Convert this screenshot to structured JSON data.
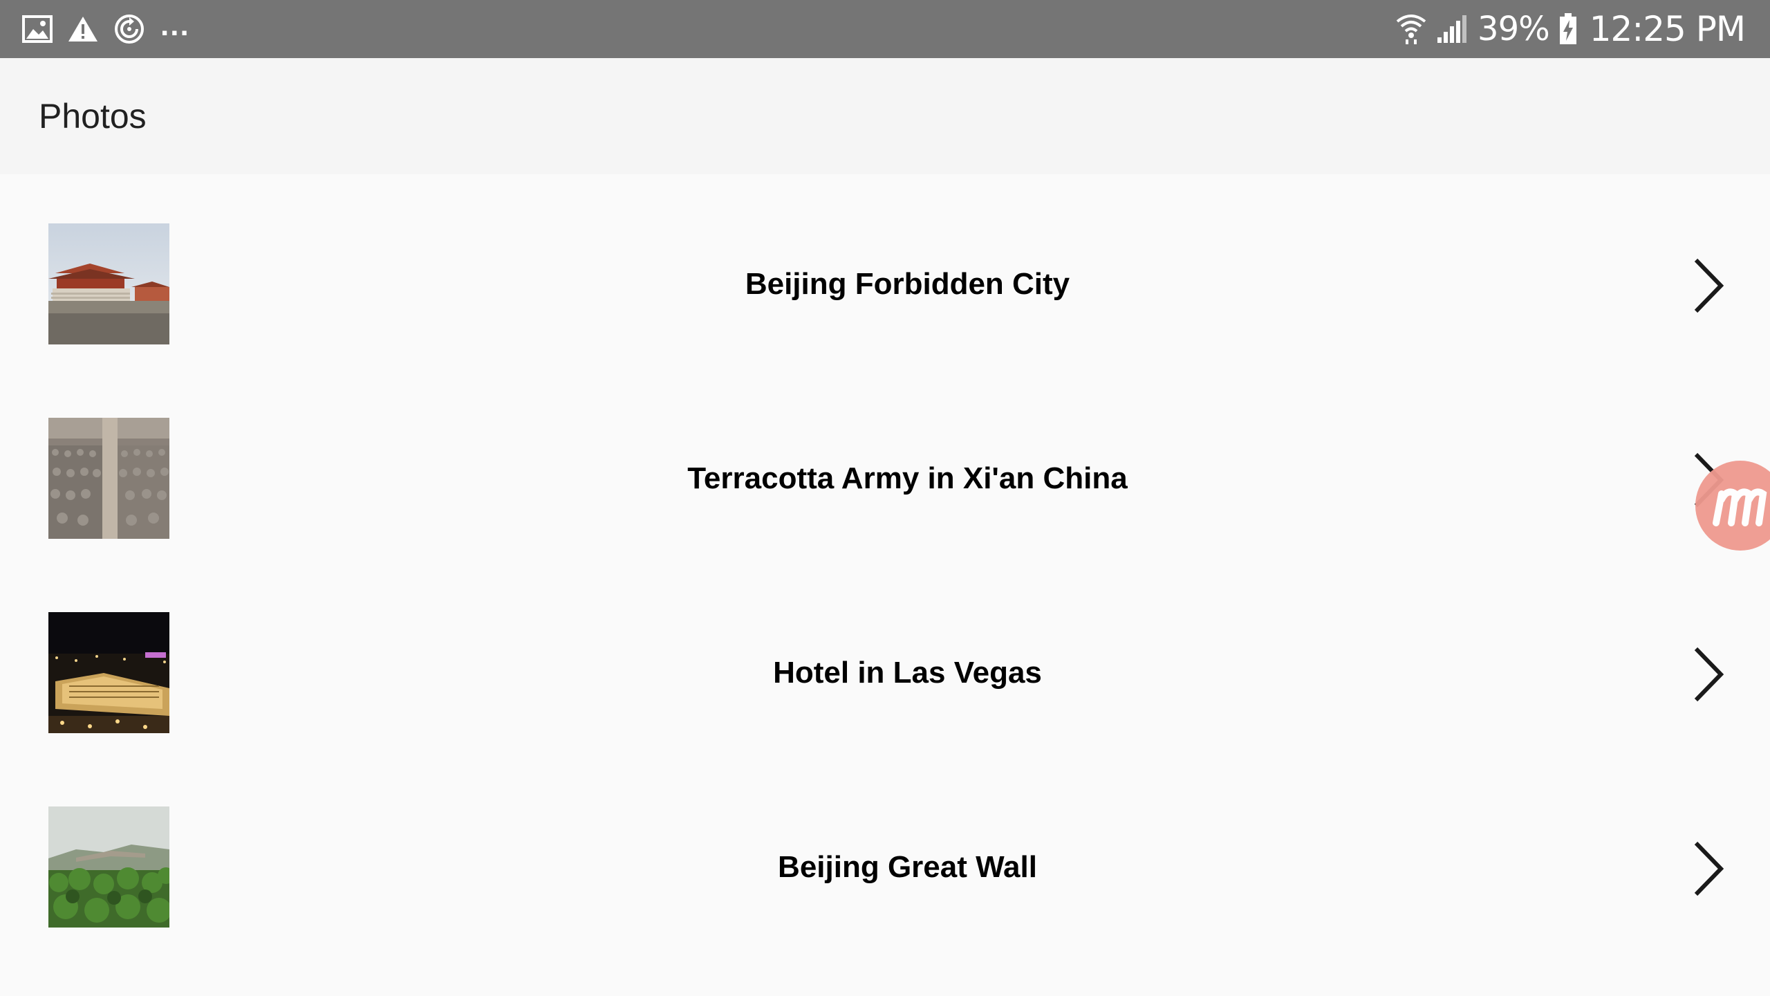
{
  "status_bar": {
    "battery_percent": "39%",
    "time": "12:25 PM",
    "more_indicator": "...",
    "icons_left": [
      "gallery-notification-icon",
      "warning-icon",
      "sync-icon"
    ],
    "icons_right": [
      "wifi-icon",
      "cellular-signal-icon",
      "battery-charging-icon"
    ]
  },
  "app_bar": {
    "title": "Photos"
  },
  "photos": [
    {
      "title": "Beijing Forbidden City",
      "thumbnail": "forbidden-city-photo"
    },
    {
      "title": "Terracotta Army in Xi'an China",
      "thumbnail": "terracotta-army-photo"
    },
    {
      "title": "Hotel in Las Vegas",
      "thumbnail": "las-vegas-hotel-photo"
    },
    {
      "title": "Beijing Great Wall",
      "thumbnail": "great-wall-photo"
    }
  ],
  "colors": {
    "status_bar": "#757575",
    "app_bar": "#f5f5f5",
    "background": "#fafafa",
    "bubble": "#ef9a8f"
  }
}
